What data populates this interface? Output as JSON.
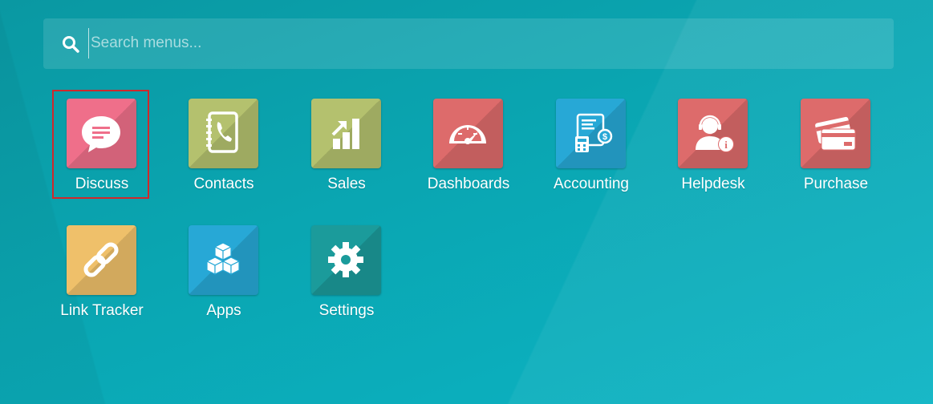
{
  "search": {
    "placeholder": "Search menus...",
    "value": "",
    "icon": "search-icon"
  },
  "apps": [
    {
      "label": "Discuss",
      "icon": "chat-bubble-icon",
      "color": "#ef6f8a"
    },
    {
      "label": "Contacts",
      "icon": "address-book-icon",
      "color": "#b4c16e"
    },
    {
      "label": "Sales",
      "icon": "sales-chart-icon",
      "color": "#b4c16e"
    },
    {
      "label": "Dashboards",
      "icon": "speedometer-icon",
      "color": "#dd6b6b"
    },
    {
      "label": "Accounting",
      "icon": "calculator-invoice-icon",
      "color": "#27a8d6"
    },
    {
      "label": "Helpdesk",
      "icon": "support-agent-icon",
      "color": "#dd6b6b"
    },
    {
      "label": "Purchase",
      "icon": "credit-card-icon",
      "color": "#dd6b6b"
    },
    {
      "label": "Link Tracker",
      "icon": "chain-link-icon",
      "color": "#efc06a"
    },
    {
      "label": "Apps",
      "icon": "cubes-icon",
      "color": "#27a8d6"
    },
    {
      "label": "Settings",
      "icon": "gear-icon",
      "color": "#1b9b9b"
    }
  ],
  "highlighted_app": "Discuss"
}
